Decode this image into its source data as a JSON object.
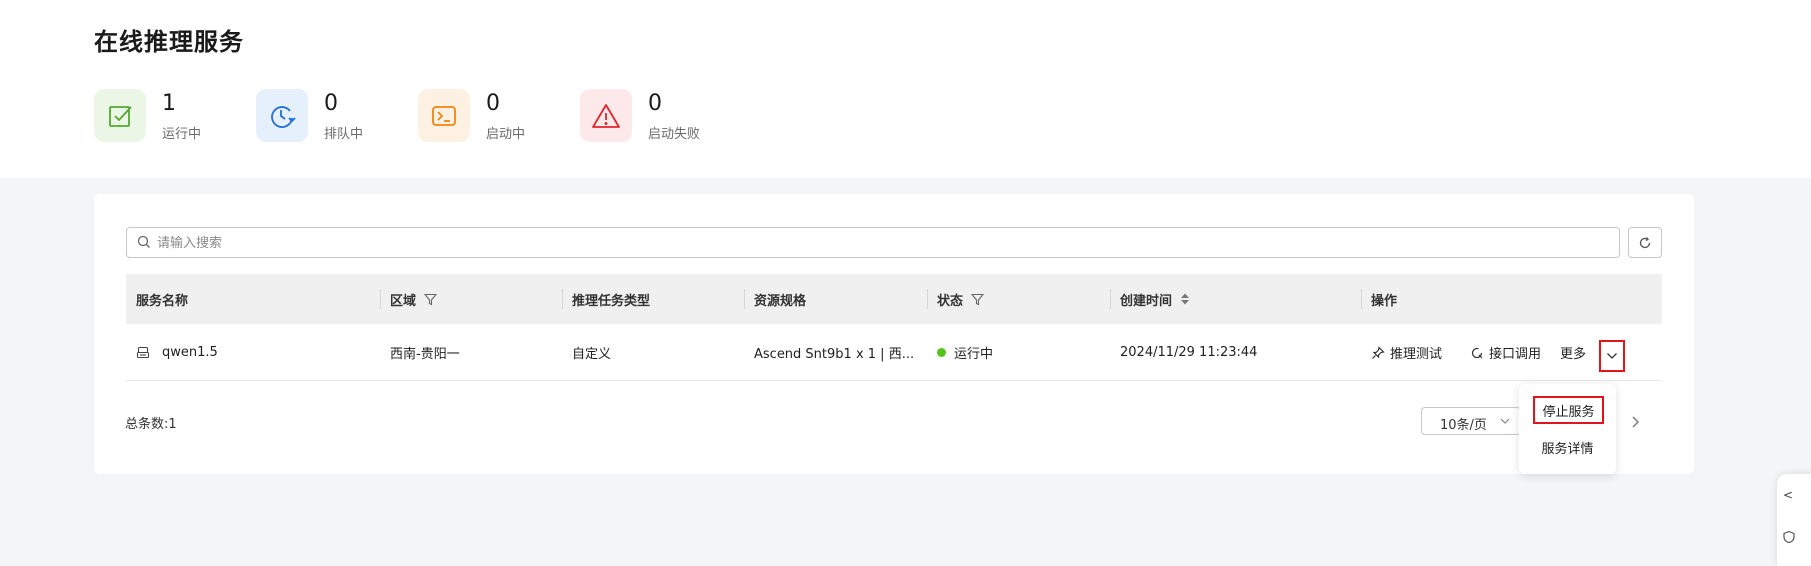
{
  "page": {
    "title": "在线推理服务"
  },
  "stats": [
    {
      "count": "1",
      "label": "运行中",
      "icon": "check-square-icon",
      "color": "#52a930",
      "bg": "#ecf6e6"
    },
    {
      "count": "0",
      "label": "排队中",
      "icon": "clock-refresh-icon",
      "color": "#1e6fd9",
      "bg": "#e6f0fc"
    },
    {
      "count": "0",
      "label": "启动中",
      "icon": "terminal-icon",
      "color": "#f0840c",
      "bg": "#fdf1e4"
    },
    {
      "count": "0",
      "label": "启动失败",
      "icon": "warning-triangle-icon",
      "color": "#e0262c",
      "bg": "#fde9ea"
    }
  ],
  "search": {
    "placeholder": "请输入搜索"
  },
  "table": {
    "columns": [
      {
        "label": "服务名称"
      },
      {
        "label": "区域",
        "icon": "filter-icon"
      },
      {
        "label": "推理任务类型"
      },
      {
        "label": "资源规格"
      },
      {
        "label": "状态",
        "icon": "filter-icon"
      },
      {
        "label": "创建时间",
        "icon": "sort-icon"
      },
      {
        "label": "操作"
      }
    ],
    "rows": [
      {
        "name": "qwen1.5",
        "region": "西南-贵阳一",
        "task_type": "自定义",
        "spec": "Ascend Snt9b1 x 1 | 西...",
        "status": "运行中",
        "status_color": "#52c41a",
        "created": "2024/11/29 11:23:44",
        "actions": {
          "test": "推理测试",
          "api": "接口调用",
          "more": "更多"
        }
      }
    ]
  },
  "footer": {
    "total": "总条数:1",
    "page_size": "10条/页"
  },
  "more_menu": {
    "items": [
      "停止服务",
      "服务详情"
    ]
  },
  "side_widget": {
    "text": "<"
  }
}
